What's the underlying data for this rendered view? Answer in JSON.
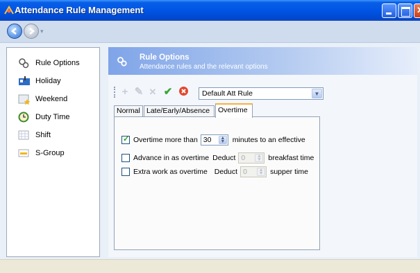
{
  "window": {
    "title": "Attendance Rule Management"
  },
  "sidebar": {
    "items": [
      {
        "label": "Rule Options",
        "icon": "rule-options-icon"
      },
      {
        "label": "Holiday",
        "icon": "holiday-icon"
      },
      {
        "label": "Weekend",
        "icon": "weekend-icon"
      },
      {
        "label": "Duty Time",
        "icon": "clock-icon"
      },
      {
        "label": "Shift",
        "icon": "shift-icon"
      },
      {
        "label": "S-Group",
        "icon": "group-icon"
      }
    ]
  },
  "header": {
    "title": "Rule Options",
    "subtitle": "Attendance rules and the relevant options"
  },
  "rule_select": {
    "value": "Default Att Rule"
  },
  "tabs": [
    {
      "label": "Normal",
      "active": false
    },
    {
      "label": "Late/Early/Absence",
      "active": false
    },
    {
      "label": "Overtime",
      "active": true
    }
  ],
  "overtime": {
    "overtime_more_than": {
      "checked": true,
      "label": "Overtime more than",
      "value": "30",
      "suffix": "minutes to an effective"
    },
    "advance_in": {
      "checked": false,
      "label": "Advance in as overtime",
      "deduct_label": "Deduct",
      "value": "0",
      "suffix": "breakfast time"
    },
    "extra_work": {
      "checked": false,
      "label": "Extra work as overtime",
      "deduct_label": "Deduct",
      "value": "0",
      "suffix": "supper time"
    }
  },
  "colors": {
    "titlebar": "#0055e5",
    "header_gradient_start": "#7fa4e8",
    "active_tab_accent": "#f5b241"
  }
}
